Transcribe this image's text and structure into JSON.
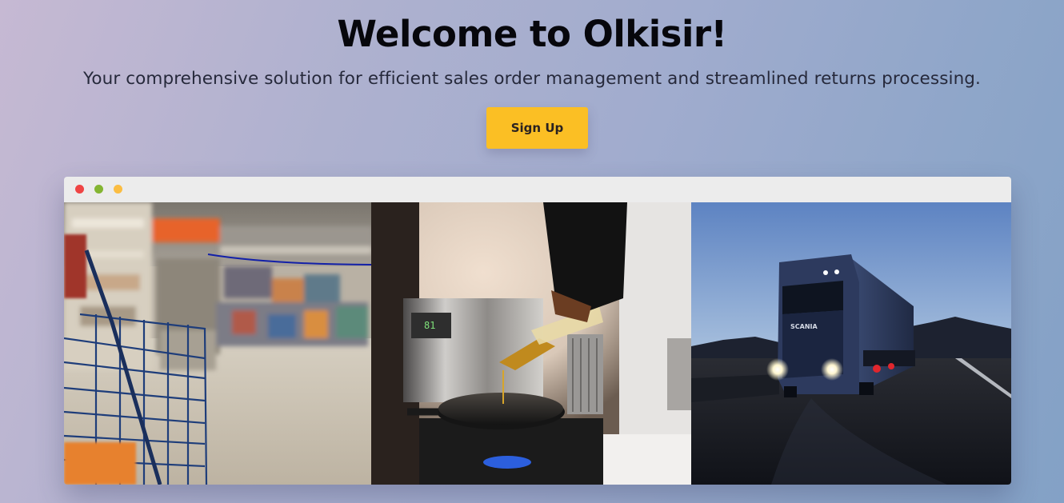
{
  "hero": {
    "title": "Welcome to Olkisir!",
    "subtitle": "Your comprehensive solution for efficient sales order management and streamlined returns processing.",
    "signup_label": "Sign Up"
  },
  "browser": {
    "window_controls": [
      "close",
      "minimize",
      "maximize"
    ]
  },
  "gallery": {
    "images": [
      {
        "subject": "supermarket-aisle-shopping-cart"
      },
      {
        "subject": "pouring-oil-into-frying-pan-on-stove"
      },
      {
        "subject": "scania-truck-on-road-at-dusk"
      }
    ],
    "truck_brand_text": "SCANIA"
  },
  "colors": {
    "accent": "#fbbf24",
    "title": "#07070c",
    "subtitle": "#26293b",
    "browser_bar": "#ececec"
  }
}
